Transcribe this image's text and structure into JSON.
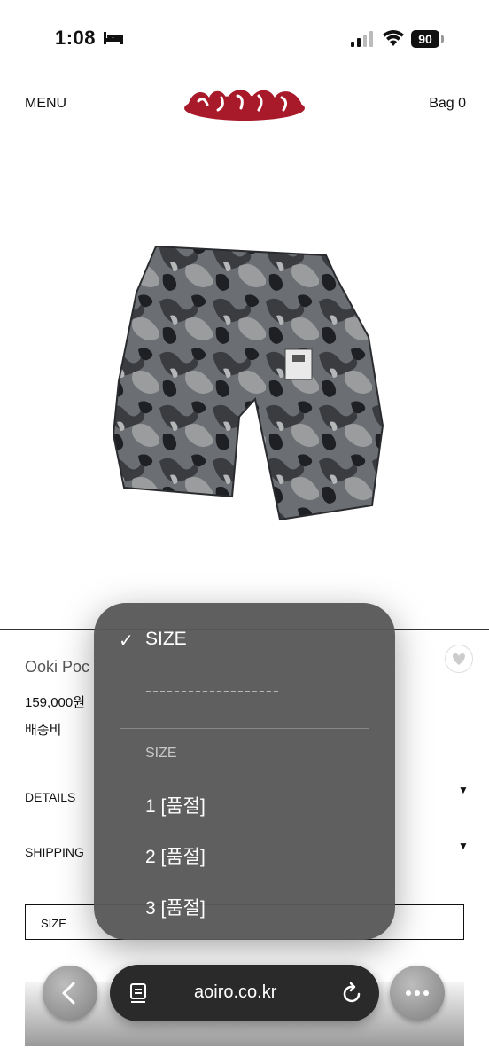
{
  "status_bar": {
    "time": "1:08",
    "battery": "90"
  },
  "header": {
    "menu": "MENU",
    "bag": "Bag 0",
    "logo_icon": "aoiro-logo"
  },
  "product": {
    "title": "Ooki Poc",
    "price": "159,000원",
    "shipping_fee": "배송비",
    "details_label": "DETAILS",
    "shipping_label": "SHIPPING",
    "size_select_label": "SIZE",
    "image_icon": "camo-shorts-image"
  },
  "dropdown": {
    "selected": "SIZE",
    "placeholder": "-------------------",
    "section_header": "SIZE",
    "options": [
      "1 [품절]",
      "2 [품절]",
      "3 [품절]"
    ]
  },
  "browser": {
    "url": "aoiro.co.kr"
  },
  "colors": {
    "logo_red": "#a8192a",
    "popup_bg": "#585858",
    "pill_bg": "#2a2a2a"
  }
}
